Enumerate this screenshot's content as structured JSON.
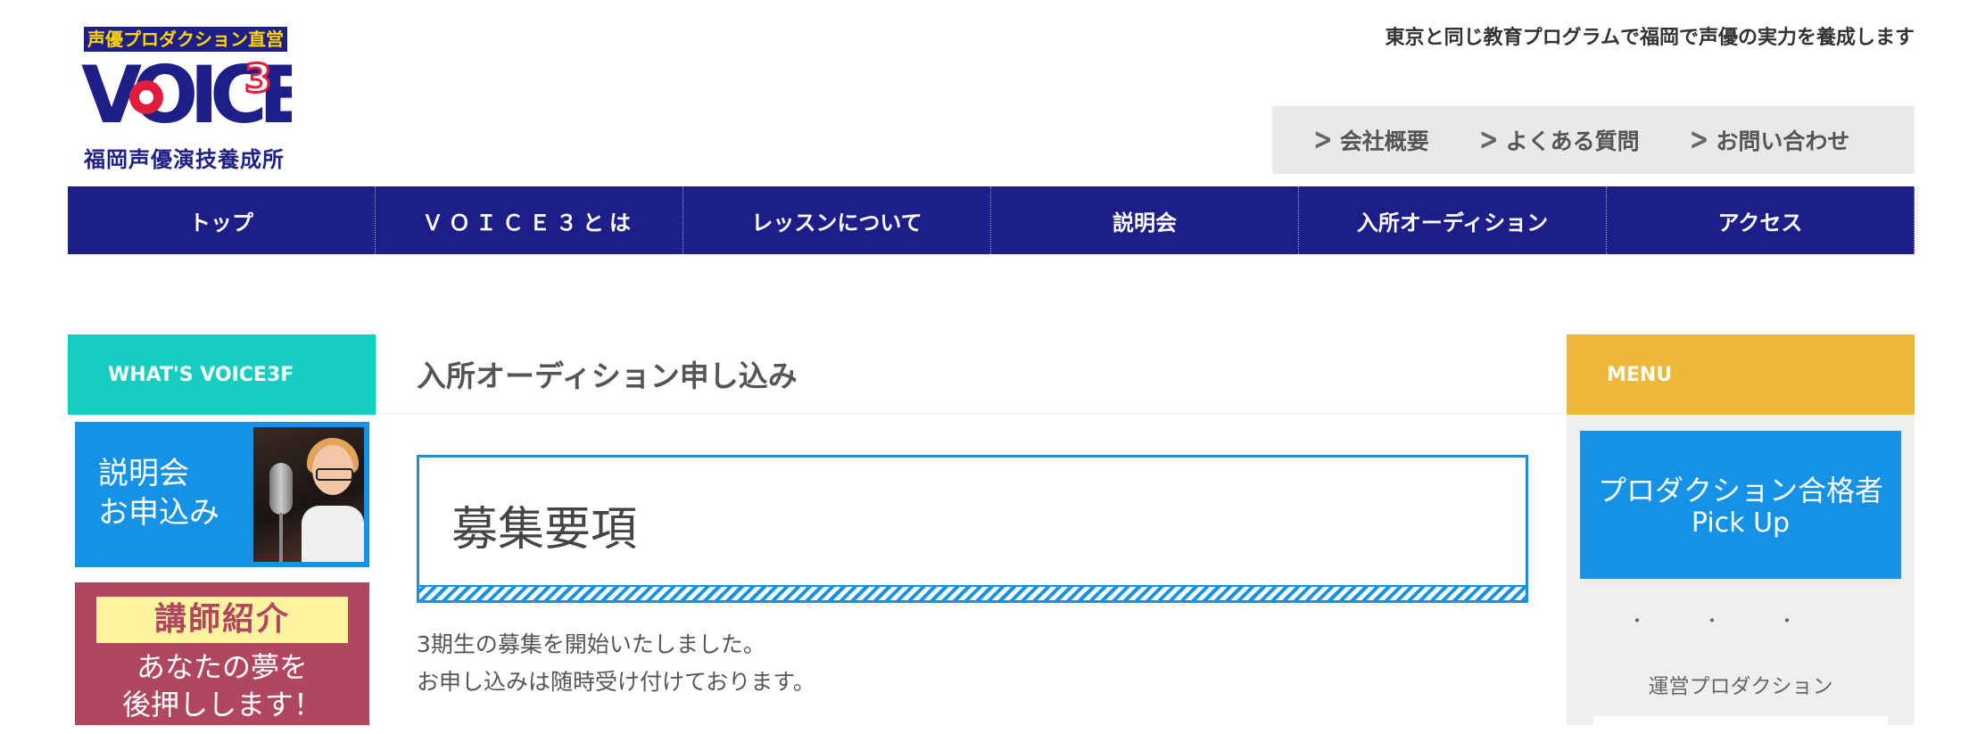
{
  "header": {
    "logo_top": "声優プロダクション直営",
    "logo_main": "VOICE",
    "logo_num": "3",
    "logo_sub": "福岡声優演技養成所",
    "tagline": "東京と同じ教育プログラムで福岡で声優の実力を養成します",
    "subnav": [
      {
        "label": "会社概要"
      },
      {
        "label": "よくある質問"
      },
      {
        "label": "お問い合わせ"
      }
    ]
  },
  "gnav": [
    {
      "label": "トップ"
    },
    {
      "label": "ＶＯＩＣＥ３とは"
    },
    {
      "label": "レッスンについて"
    },
    {
      "label": "説明会"
    },
    {
      "label": "入所オーディション"
    },
    {
      "label": "アクセス"
    }
  ],
  "left_sidebar": {
    "heading": "WHAT'S VOICE3F",
    "banner1": {
      "line1": "説明会",
      "line2": "お申込み"
    },
    "banner2": {
      "ribbon": "講師紹介",
      "line1": "あなたの夢を",
      "line2": "後押しします！"
    }
  },
  "main": {
    "title": "入所オーディション申し込み",
    "box_heading": "募集要項",
    "paragraphs": [
      "3期生の募集を開始いたしました。",
      "お申し込みは随時受け付けております。"
    ]
  },
  "right_sidebar": {
    "heading": "MENU",
    "pickup": {
      "line1": "プロダクション合格者",
      "line2": "Pick Up"
    },
    "dots": "・・・",
    "unei": "運営プロダクション"
  },
  "colors": {
    "navy": "#1e1e88",
    "teal": "#16cdc0",
    "yellow": "#eeb83b",
    "blue": "#1592e6",
    "rose": "#b0475f",
    "logo_red": "#e01e3c"
  }
}
